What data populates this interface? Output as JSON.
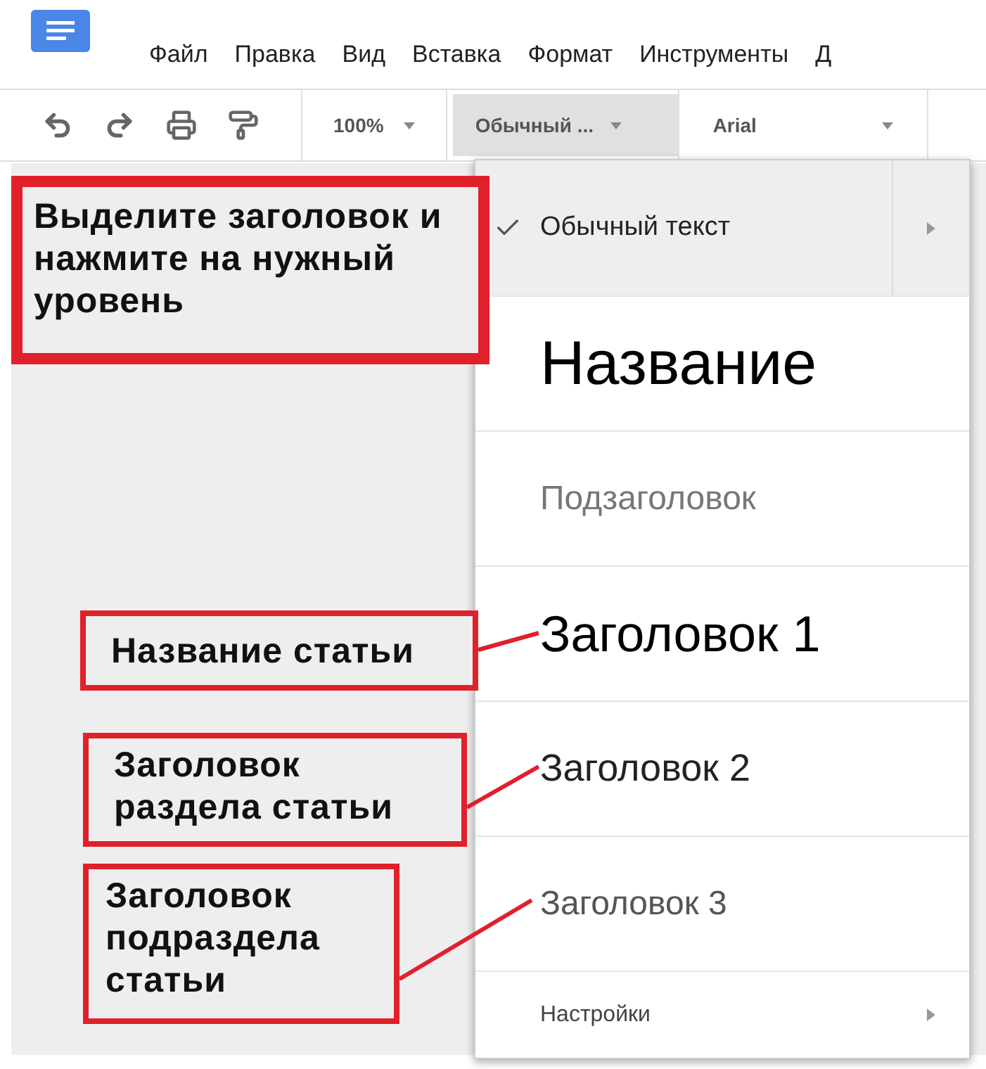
{
  "menu_bar": [
    "Файл",
    "Правка",
    "Вид",
    "Вставка",
    "Формат",
    "Инструменты",
    "Д"
  ],
  "toolbar": {
    "zoom": "100%",
    "style": "Обычный ...",
    "font": "Arial"
  },
  "style_menu": {
    "items": [
      {
        "label": "Обычный текст",
        "kind": "normal",
        "selected": true,
        "submenu": true
      },
      {
        "label": "Название",
        "kind": "title",
        "selected": false,
        "submenu": false
      },
      {
        "label": "Подзаголовок",
        "kind": "subtitle",
        "selected": false,
        "submenu": false
      },
      {
        "label": "Заголовок 1",
        "kind": "h1",
        "selected": false,
        "submenu": false
      },
      {
        "label": "Заголовок 2",
        "kind": "h2",
        "selected": false,
        "submenu": false
      },
      {
        "label": "Заголовок 3",
        "kind": "h3",
        "selected": false,
        "submenu": false
      },
      {
        "label": "Настройки",
        "kind": "settings",
        "selected": false,
        "submenu": true
      }
    ]
  },
  "callouts": [
    {
      "text": "Выделите заголовок и нажмите на нужный уровень",
      "leader": false
    },
    {
      "text": "Название статьи",
      "leader": true
    },
    {
      "text": "Заголовок раздела статьи",
      "leader": true
    },
    {
      "text": "Заголовок подраздела статьи",
      "leader": true
    }
  ]
}
